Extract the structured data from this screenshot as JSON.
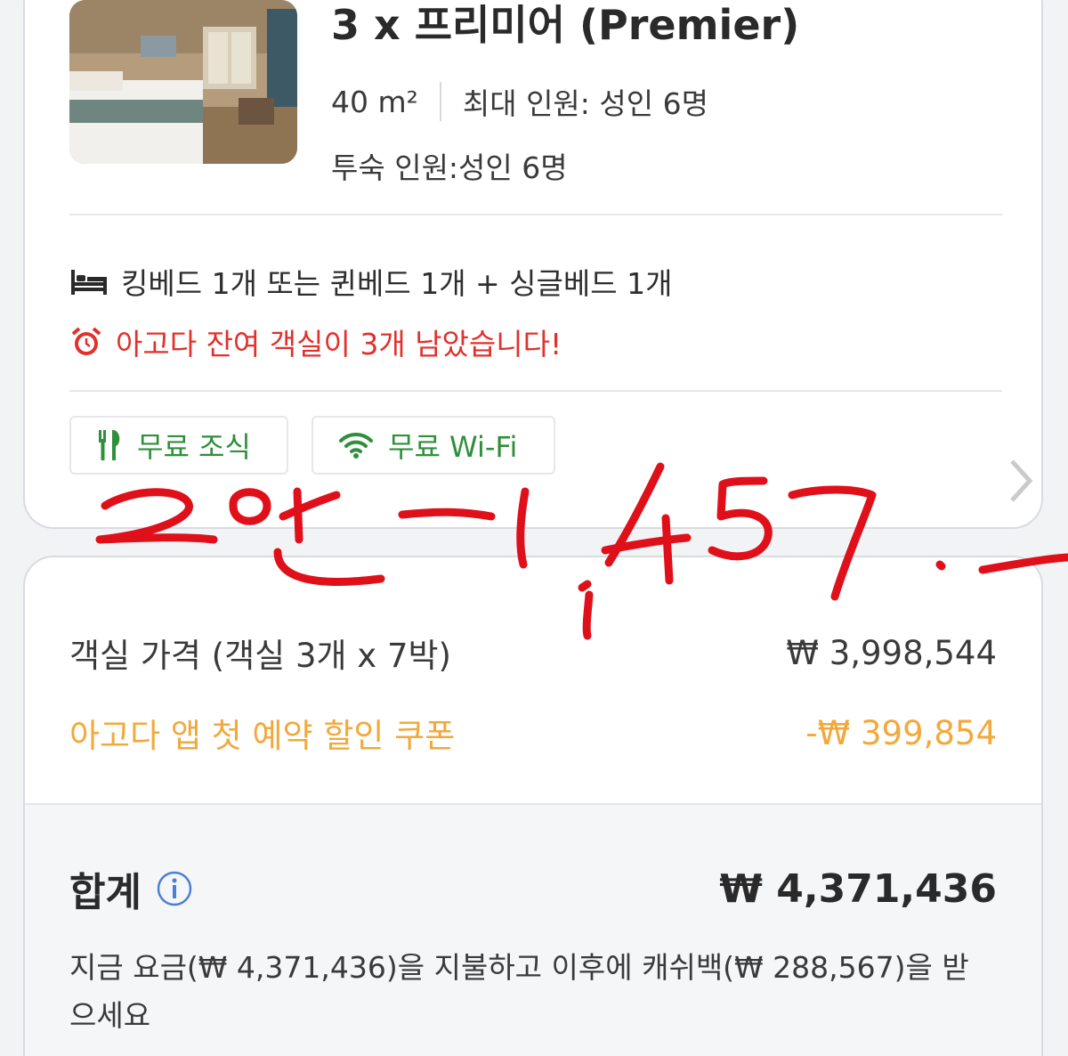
{
  "room": {
    "title": "3 x 프리미어 (Premier)",
    "size": "40 m²",
    "max_occupancy": "최대 인원: 성인 6명",
    "guests": "투숙 인원:성인 6명",
    "bed": "킹베드 1개 또는 퀸베드 1개 + 싱글베드 1개",
    "availability_alert": "아고다 잔여 객실이 3개 남았습니다!",
    "amenities": [
      {
        "label": "무료 조식",
        "icon": "utensils-icon"
      },
      {
        "label": "무료 Wi-Fi",
        "icon": "wifi-icon"
      }
    ]
  },
  "pricing": {
    "room_price_label": "객실 가격 (객실 3개 x 7박)",
    "room_price_value": "₩ 3,998,544",
    "coupon_label": "아고다 앱 첫 예약 할인 쿠폰",
    "coupon_value": "-₩ 399,854",
    "total_label": "합계",
    "total_value": "₩ 4,371,436",
    "cashback_note": "지금 요금(₩ 4,371,436)을 지불하고 이후에 캐쉬백(₩ 288,567)을 받으세요"
  },
  "colors": {
    "alert": "#e0312c",
    "amenity": "#2f8f3a",
    "coupon": "#f2a93b",
    "handwriting": "#e0101a",
    "info": "#4a7fd6"
  }
}
